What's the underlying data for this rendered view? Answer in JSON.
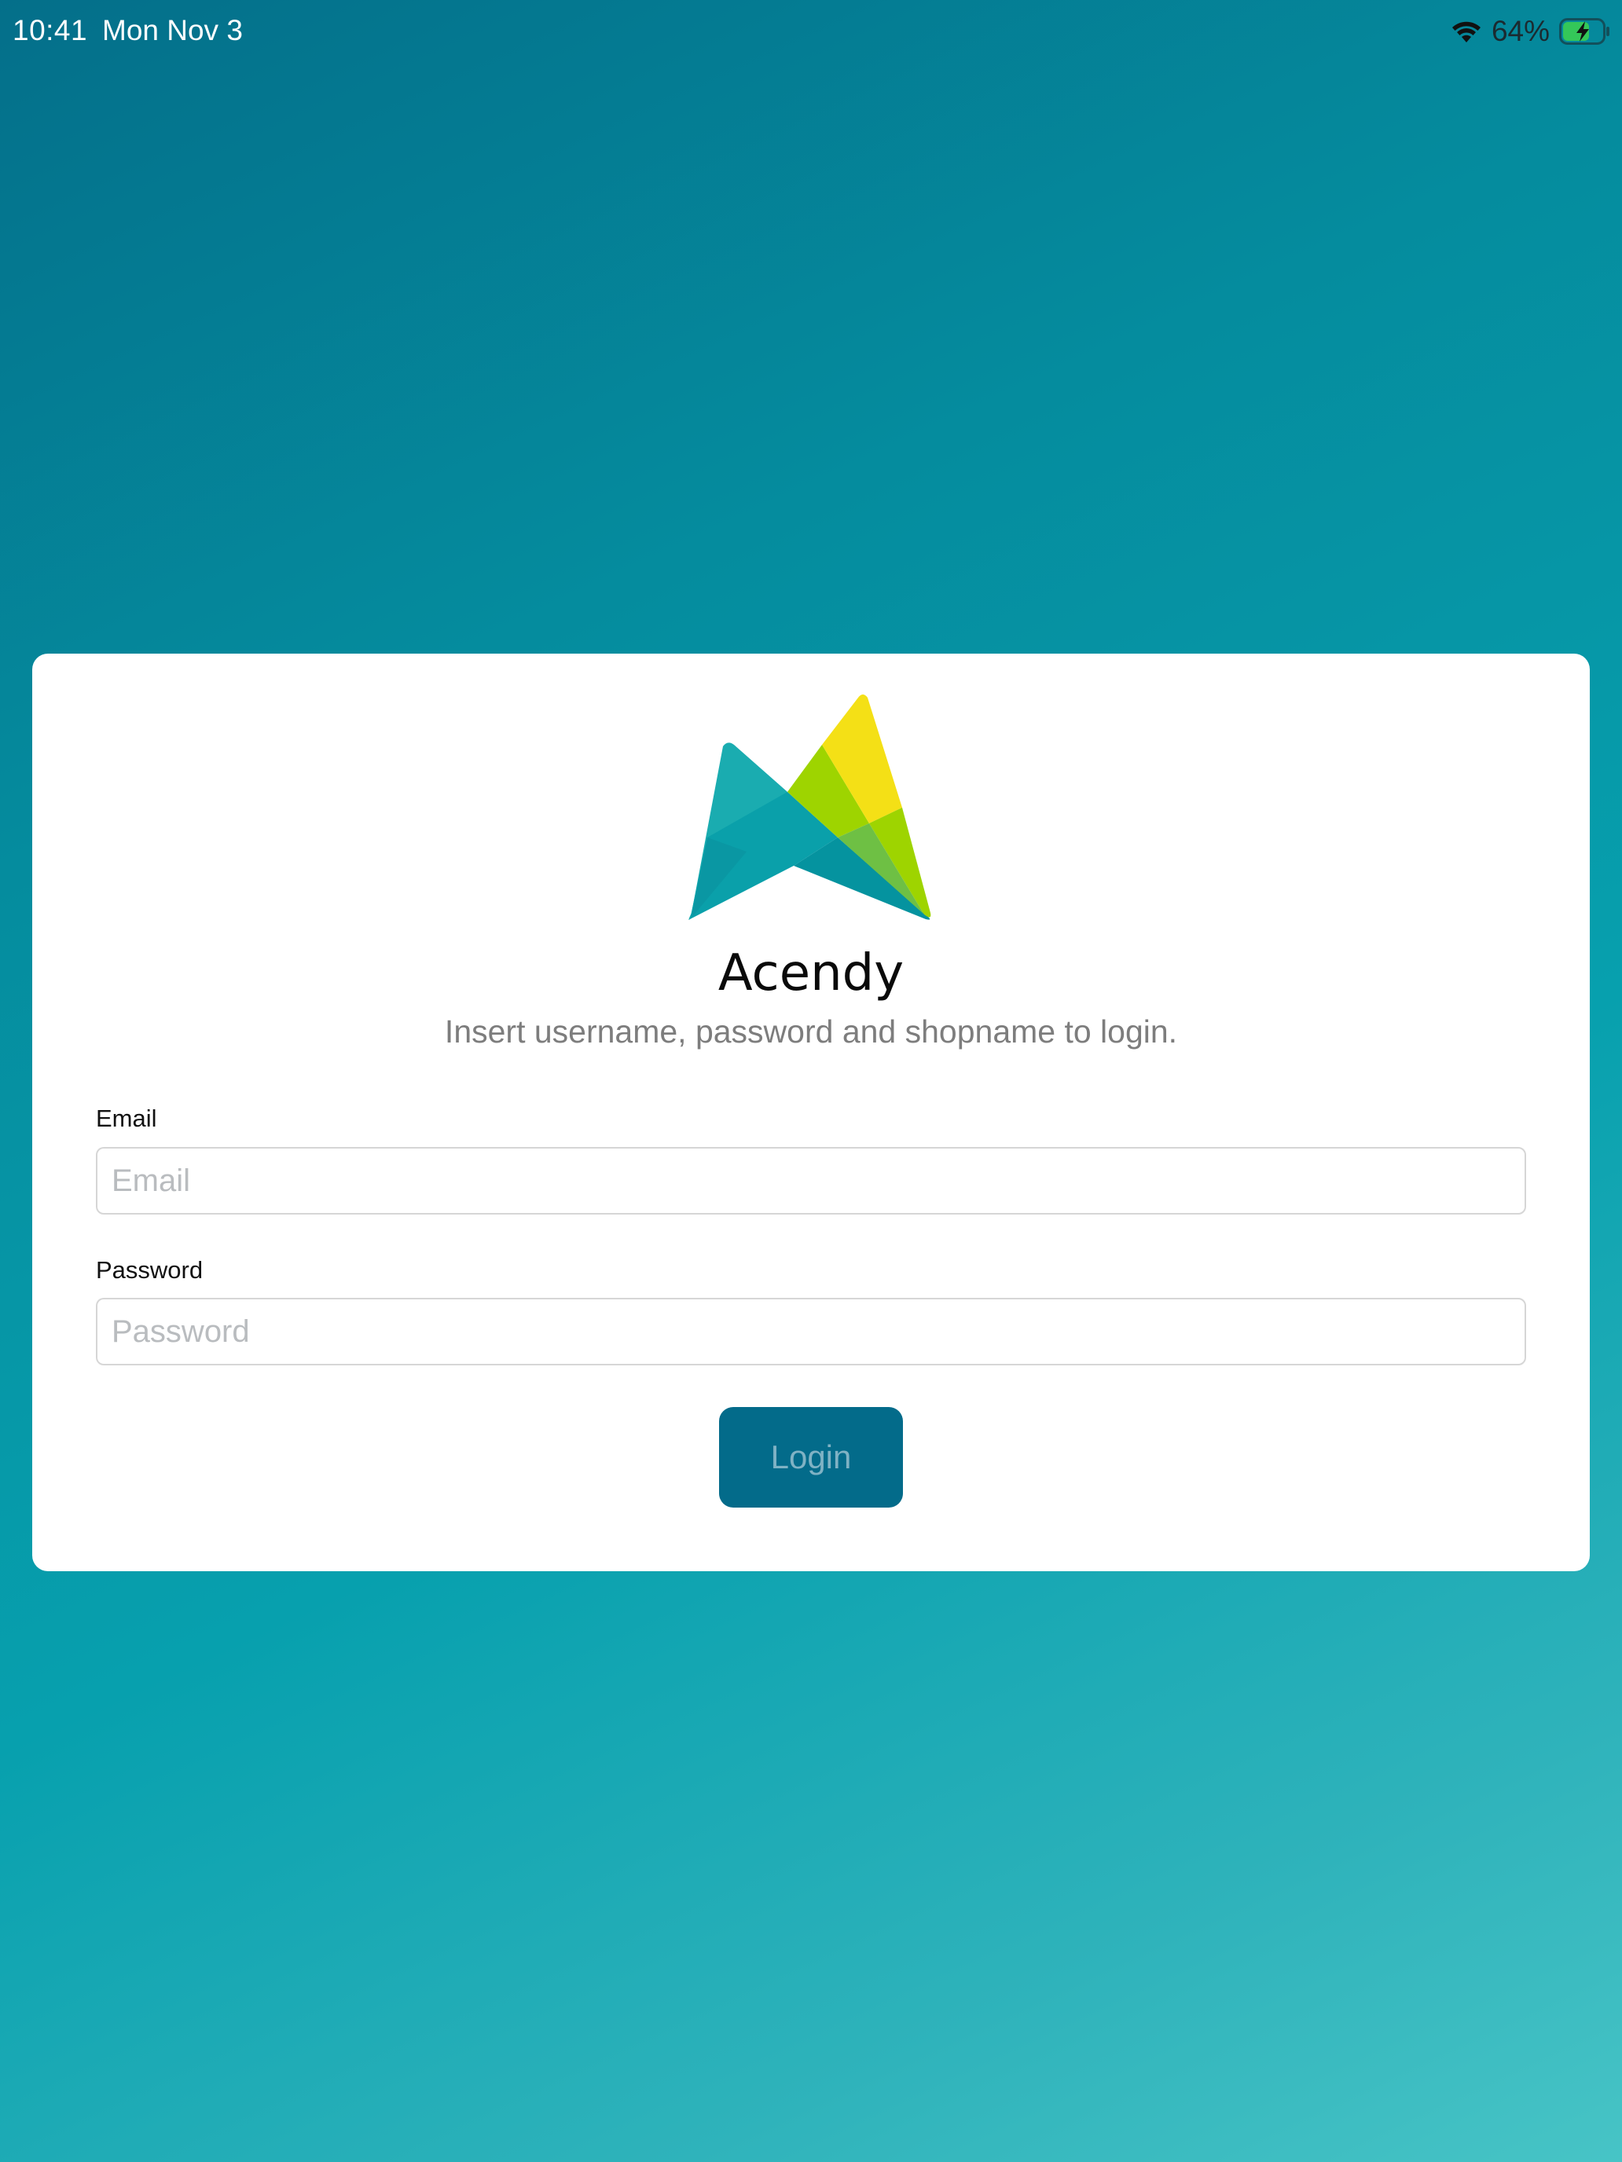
{
  "status_bar": {
    "time": "10:41",
    "date": "Mon Nov 3",
    "battery_percent": "64%",
    "icons": [
      "wifi-icon",
      "battery-charging-icon"
    ]
  },
  "login": {
    "brand_name": "Acendy",
    "subtitle": "Insert username, password and shopname to login.",
    "email_label": "Email",
    "email_placeholder": "Email",
    "email_value": "",
    "password_label": "Password",
    "password_placeholder": "Password",
    "password_value": "",
    "login_button_label": "Login"
  },
  "colors": {
    "background_top": "#046f8a",
    "background_bottom": "#47c4c6",
    "button_bg": "#036b8a",
    "button_text": "#7fb2c4",
    "battery_fill": "#34c759",
    "logo_teal": "#17a8b0",
    "logo_green": "#9ed400",
    "logo_yellow": "#f4e016"
  }
}
